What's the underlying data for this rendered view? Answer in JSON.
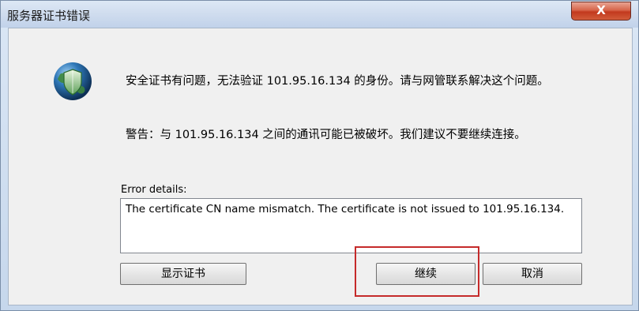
{
  "window": {
    "title": "服务器证书错误",
    "close_label": "X"
  },
  "messages": {
    "line1": "安全证书有问题，无法验证 101.95.16.134 的身份。请与网管联系解决这个问题。",
    "line2": "警告：与 101.95.16.134 之间的通讯可能已被破坏。我们建议不要继续连接。"
  },
  "error": {
    "label": "Error details:",
    "details": "The certificate CN name mismatch. The certificate is not issued to 101.95.16.134."
  },
  "buttons": {
    "show_certificate": "显示证书",
    "continue": "继续",
    "cancel": "取消"
  },
  "icons": {
    "window_logo": "globe-shield-icon"
  },
  "colors": {
    "highlight": "#c52a2a",
    "close_button": "#c2391e"
  }
}
